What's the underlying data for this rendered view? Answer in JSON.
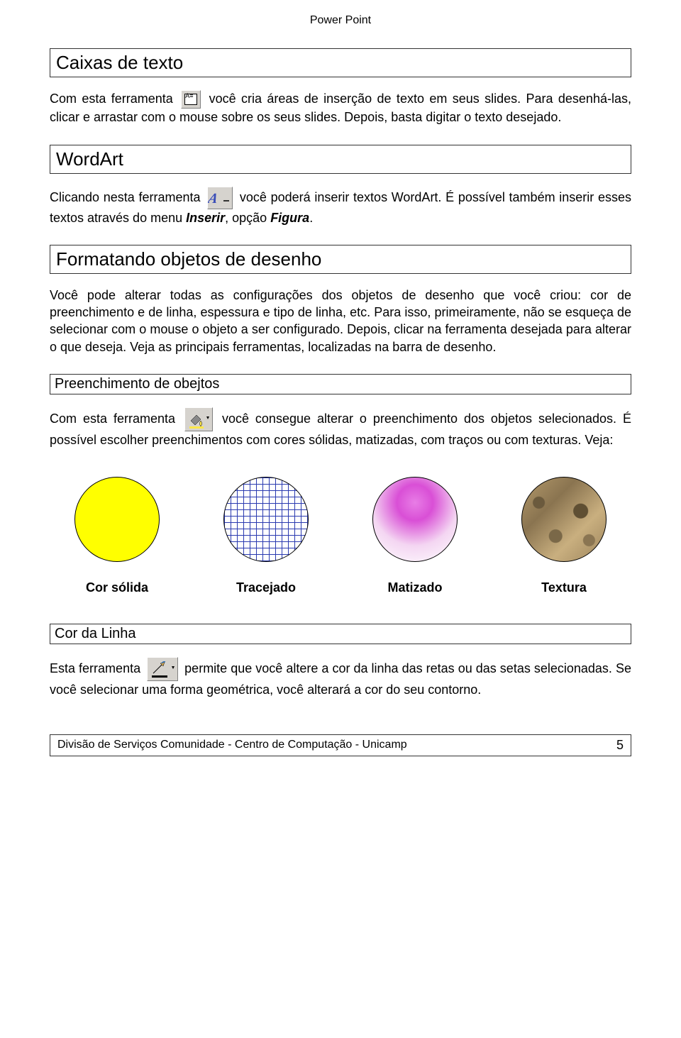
{
  "header": {
    "title": "Power Point"
  },
  "sections": {
    "caixas": {
      "heading": "Caixas de texto",
      "p1a": "Com esta ferramenta ",
      "p1b": " você cria áreas de inserção de texto em seus slides. Para desenhá-las, clicar e arrastar com o mouse sobre os seus slides. Depois, basta digitar o texto desejado."
    },
    "wordart": {
      "heading": "WordArt",
      "p1a": "Clicando nesta ferramenta ",
      "p1b": " você poderá inserir textos WordArt. É possível também inserir esses textos através do menu ",
      "menu": "Inserir",
      "p1c": ", opção ",
      "opt": "Figura",
      "p1d": "."
    },
    "formatando": {
      "heading": "Formatando objetos de desenho",
      "p1": "Você pode alterar todas as configurações dos objetos de desenho que você criou: cor de preenchimento e de linha, espessura e tipo de linha, etc. Para isso, primeiramente, não se esqueça de selecionar com o mouse o objeto a ser configurado. Depois, clicar na ferramenta desejada para alterar o que deseja. Veja as principais ferramentas, localizadas na barra de desenho."
    },
    "preenchimento": {
      "heading": "Preenchimento de obejtos",
      "p1a": "Com esta ferramenta ",
      "p1b": " você consegue alterar o preenchimento dos objetos selecionados. É possível escolher preenchimentos com cores sólidas, matizadas, com traços ou com texturas. Veja:",
      "samples": {
        "solid": "Cor sólida",
        "hatch": "Tracejado",
        "grad": "Matizado",
        "tex": "Textura"
      }
    },
    "corlinha": {
      "heading": "Cor da Linha",
      "p1a": "Esta ferramenta ",
      "p1b": " permite que você altere a cor da linha das retas ou das setas selecionadas. Se você selecionar uma forma geométrica, você alterará a cor do seu contorno."
    }
  },
  "footer": {
    "text": "Divisão de Serviços Comunidade - Centro de Computação - Unicamp",
    "page": "5"
  }
}
